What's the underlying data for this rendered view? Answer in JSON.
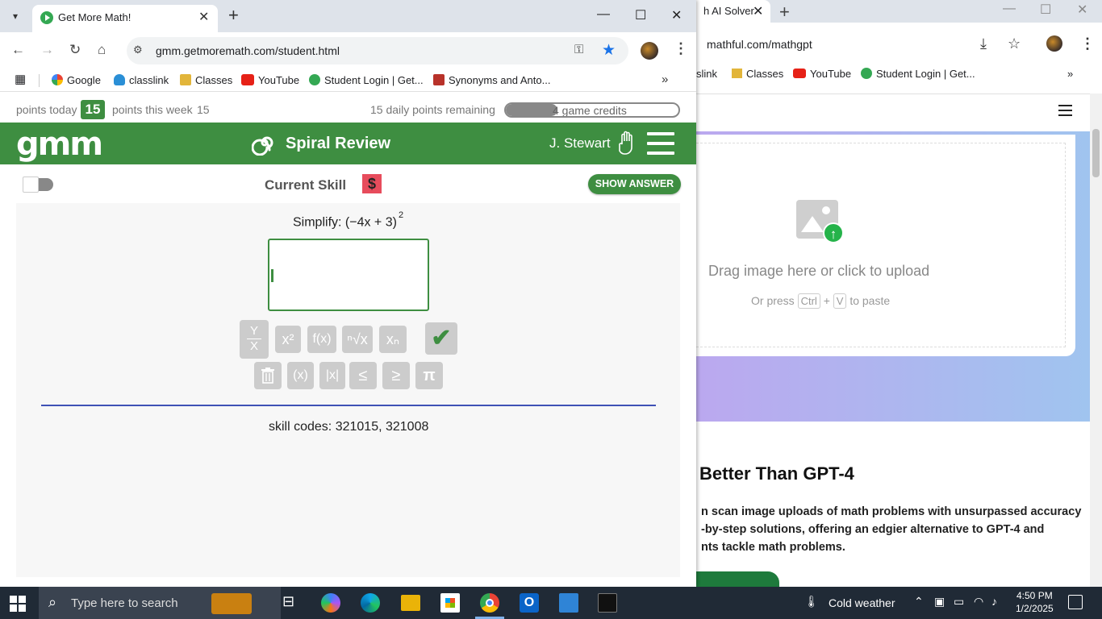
{
  "right_window": {
    "tab_title": "h AI Solver",
    "url": "mathful.com/mathgpt",
    "bookmarks": [
      "slink",
      "Classes",
      "YouTube",
      "Student Login | Get..."
    ],
    "upload": {
      "drag_text": "Drag image here or click to upload",
      "paste_prefix": "Or press",
      "key_ctrl": "Ctrl",
      "plus": "+",
      "key_v": "V",
      "paste_suffix": "to paste"
    },
    "headline": "Better Than GPT-4",
    "body_lines": [
      "n scan image uploads of math problems with unsurpassed accuracy",
      "-by-step solutions, offering an edgier alternative to GPT-4 and",
      "nts tackle math problems."
    ]
  },
  "left_window": {
    "tab_title": "Get More Math!",
    "url": "gmm.getmoremath.com/student.html",
    "bookmarks": [
      "Google",
      "classlink",
      "Classes",
      "YouTube",
      "Student Login | Get...",
      "Synonyms and Anto..."
    ]
  },
  "gmm": {
    "points_today_label": "points today",
    "points_today": "15",
    "points_week_label": "points this week",
    "points_week": "15",
    "daily_remaining": "15 daily points remaining",
    "game_credits_text": "4 game credits",
    "game_credits_fill": 0.3,
    "logo": "gmm",
    "title": "Spiral Review",
    "user": "J. Stewart",
    "current_skill": "Current Skill",
    "dollar": "$",
    "show_answer": "SHOW ANSWER",
    "question_prefix": "Simplify: (−4x + 3)",
    "question_exponent": "2",
    "math_buttons_row1": [
      "Y/X",
      "x²",
      "f(x)",
      "ⁿ√x",
      "xₙ"
    ],
    "math_buttons_row2": [
      "trash-icon",
      "(x)",
      "|x|",
      "≤",
      "≥",
      "π"
    ],
    "check": "✔",
    "skill_codes": "skill codes: 321015, 321008"
  },
  "taskbar": {
    "search_placeholder": "Type here to search",
    "weather": "Cold weather",
    "time": "4:50 PM",
    "date": "1/2/2025"
  },
  "colors": {
    "gmm_green": "#3e8e41",
    "taskbar": "#202a36",
    "chrome_tabbar": "#dee3ea",
    "dollar_red": "#e74c5c",
    "divider_blue": "#3f51b5"
  }
}
